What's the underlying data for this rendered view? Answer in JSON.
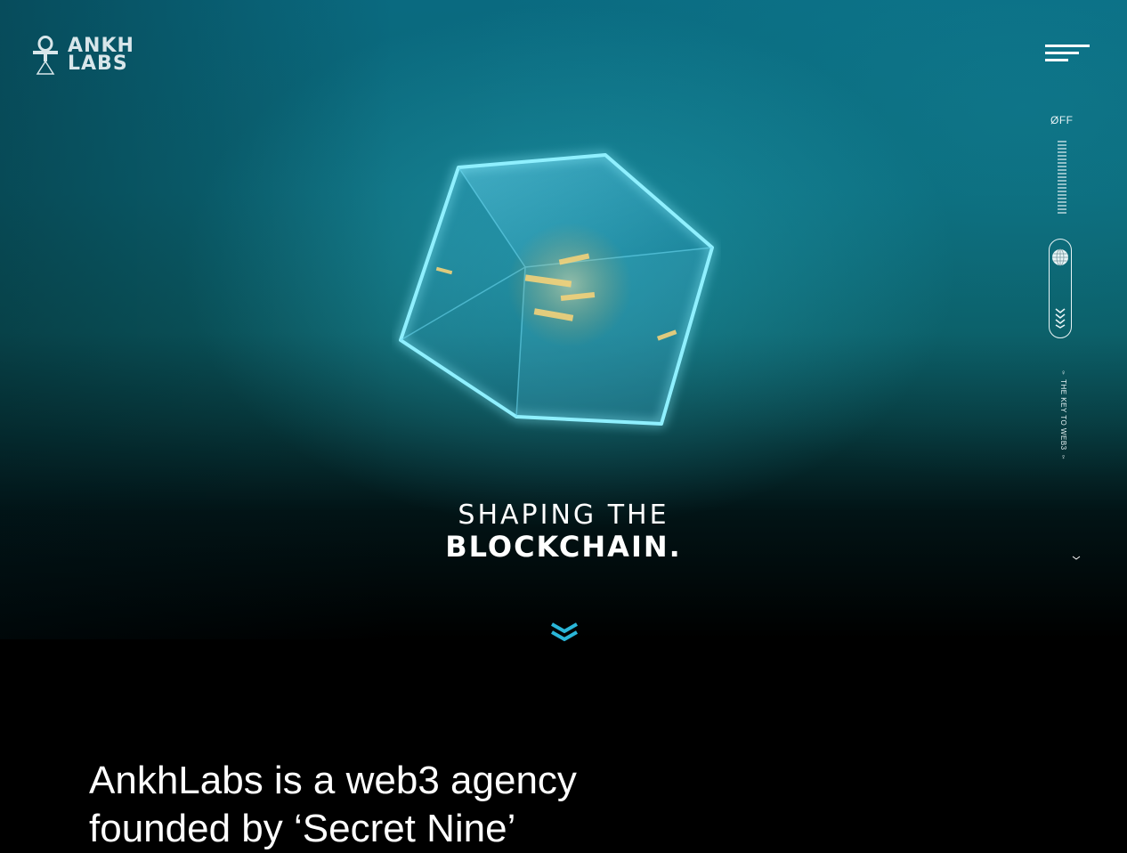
{
  "brand": {
    "line1": "ANKH",
    "line2": "LABS",
    "accent": "#2ab6d8"
  },
  "sidebar": {
    "sound_label": "ØFF",
    "tagline": "♀ THE KEY TO WEB3 ♀",
    "icons": [
      "globe-icon",
      "zigzag-icon"
    ]
  },
  "hero": {
    "title_line1": "SHAPING THE",
    "title_line2": "BLOCKCHAIN."
  },
  "intro": {
    "text": "AnkhLabs is a web3 agency founded by ‘Secret Nine’"
  },
  "colors": {
    "hero_top": "#0a6a80",
    "background": "#000000",
    "glow": "#5fe4ff"
  }
}
